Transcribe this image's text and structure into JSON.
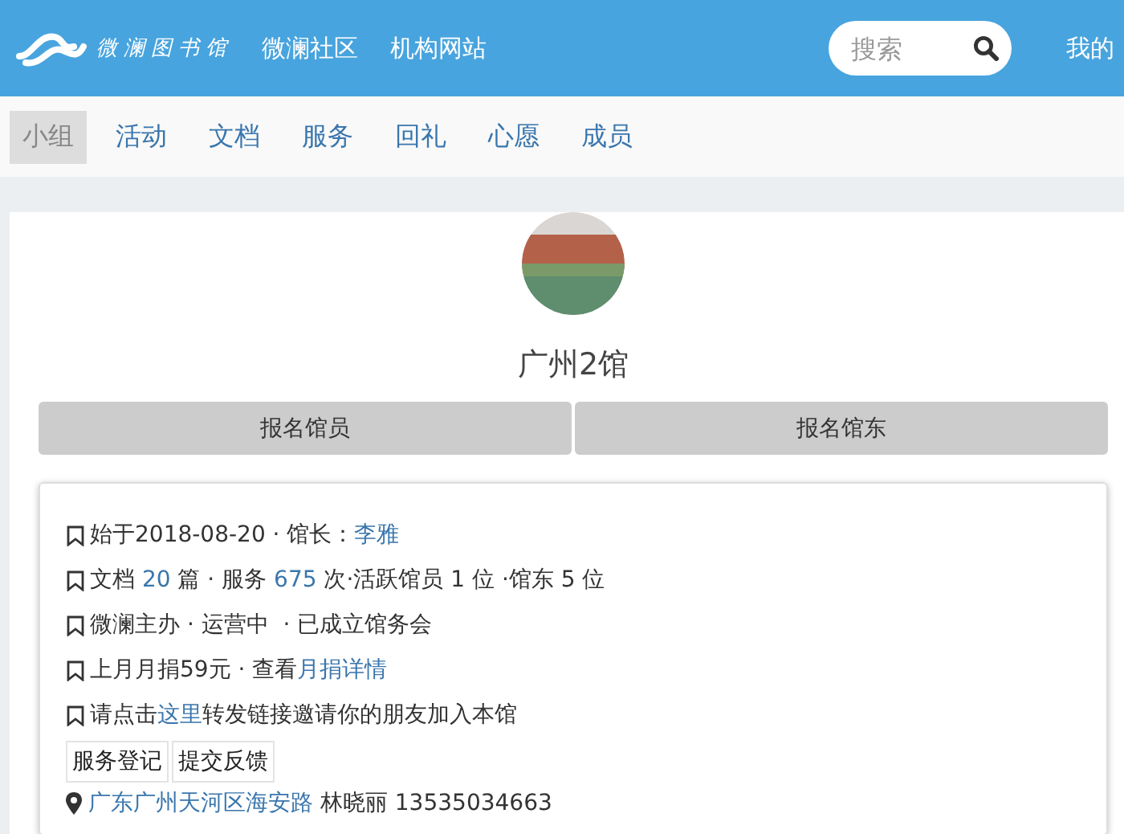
{
  "header": {
    "logo_text": "微澜图书馆",
    "links": [
      "微澜社区",
      "机构网站"
    ],
    "search": {
      "placeholder": "搜索"
    },
    "user_link": "我的"
  },
  "tabs": [
    {
      "label": "小组",
      "selected": true
    },
    {
      "label": "活动",
      "selected": false
    },
    {
      "label": "文档",
      "selected": false
    },
    {
      "label": "服务",
      "selected": false
    },
    {
      "label": "回礼",
      "selected": false
    },
    {
      "label": "心愿",
      "selected": false
    },
    {
      "label": "成员",
      "selected": false
    }
  ],
  "library": {
    "name": "广州2馆",
    "join_buttons": [
      "报名馆员",
      "报名馆东"
    ]
  },
  "info_lines": [
    [
      {
        "kind": "text",
        "text": "始于2018-08-20 · 馆长："
      },
      {
        "kind": "link",
        "text": "李雅"
      }
    ],
    [
      {
        "kind": "text",
        "text": "文档 "
      },
      {
        "kind": "link",
        "text": "20"
      },
      {
        "kind": "text",
        "text": " 篇 · 服务 "
      },
      {
        "kind": "link",
        "text": "675"
      },
      {
        "kind": "text",
        "text": " 次·活跃馆员 1 位 ·馆东 5 位"
      }
    ],
    [
      {
        "kind": "text",
        "text": "微澜主办 · 运营中  · 已成立馆务会"
      }
    ],
    [
      {
        "kind": "text",
        "text": "上月月捐59元 · 查看"
      },
      {
        "kind": "link",
        "text": "月捐详情"
      }
    ],
    [
      {
        "kind": "text",
        "text": "请点击"
      },
      {
        "kind": "link",
        "text": "这里"
      },
      {
        "kind": "text",
        "text": "转发链接邀请你的朋友加入本馆"
      }
    ]
  ],
  "action_buttons": [
    "服务登记",
    "提交反馈"
  ],
  "address": {
    "place": "广东广州天河区海安路",
    "contact": "林晓丽 13535034663"
  }
}
